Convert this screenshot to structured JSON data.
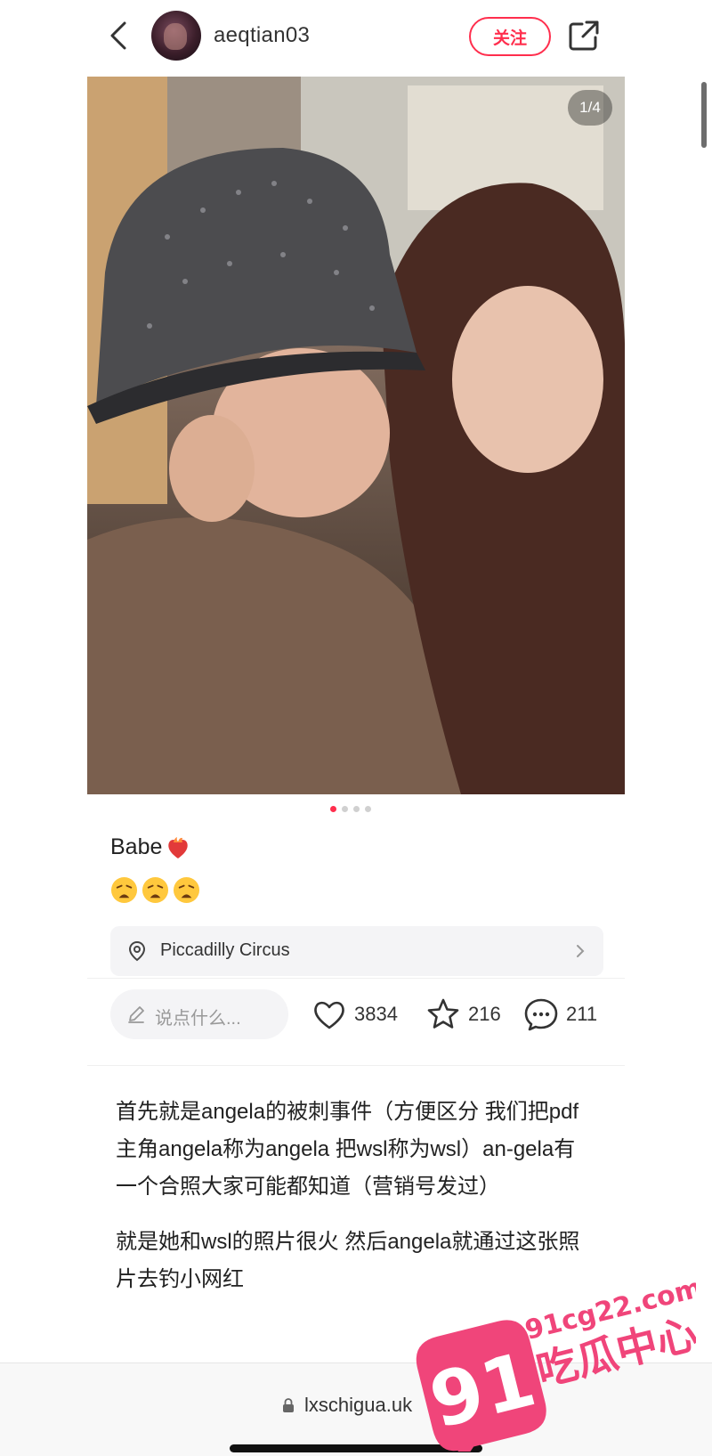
{
  "header": {
    "username": "aeqtian03",
    "follow_label": "关注",
    "icons": [
      "back-arrow-icon",
      "avatar",
      "share-icon"
    ]
  },
  "photo": {
    "counter": "1/4",
    "page_total": 4,
    "page_current": 1
  },
  "post": {
    "caption": "Babe",
    "caption_emoji": "heart-on-fire",
    "emoji_row": [
      "weary-face",
      "weary-face",
      "weary-face"
    ]
  },
  "location": {
    "name": "Piccadilly Circus"
  },
  "actions": {
    "comment_placeholder": "说点什么...",
    "likes": "3834",
    "favorites": "216",
    "comments": "211"
  },
  "article": {
    "paragraphs": [
      "首先就是angela的被刺事件（方便区分 我们把pdf主角angela称为angela 把wsl称为wsl）an-gela有一个合照大家可能都知道（营销号发过）",
      "就是她和wsl的照片很火 然后angela就通过这张照片去钓小网红"
    ]
  },
  "browser": {
    "url": "lxschigua.uk"
  },
  "watermark": {
    "number": "91",
    "domain": "91cg22.com",
    "brand": "吃瓜中心"
  },
  "colors": {
    "accent": "#ff2e4d",
    "watermark_pink": "#f0457a"
  }
}
